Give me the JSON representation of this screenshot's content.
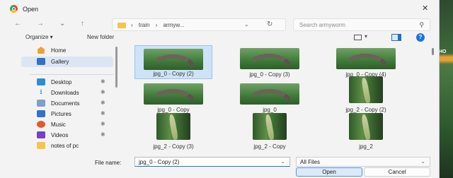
{
  "window": {
    "title": "Open",
    "close_icon": "close-icon"
  },
  "nav": {
    "back": "←",
    "forward": "→",
    "dropdown": "⌄",
    "up": "↑",
    "breadcrumb": [
      "train",
      "armyw..."
    ],
    "refresh": "↻",
    "search_placeholder": "Search armyworm"
  },
  "toolbar": {
    "organize": "Organize ▾",
    "new_folder": "New folder"
  },
  "sidebar": {
    "items": [
      {
        "label": "Home",
        "icon": "home-icon",
        "pinned": false
      },
      {
        "label": "Gallery",
        "icon": "gallery-icon",
        "pinned": false,
        "selected": true
      },
      {
        "label": "Desktop",
        "icon": "desktop-icon",
        "pinned": true
      },
      {
        "label": "Downloads",
        "icon": "download-icon",
        "pinned": true
      },
      {
        "label": "Documents",
        "icon": "documents-icon",
        "pinned": true
      },
      {
        "label": "Pictures",
        "icon": "pictures-icon",
        "pinned": true
      },
      {
        "label": "Music",
        "icon": "music-icon",
        "pinned": true
      },
      {
        "label": "Videos",
        "icon": "videos-icon",
        "pinned": true
      },
      {
        "label": "notes of pc",
        "icon": "folder-icon",
        "pinned": false
      }
    ]
  },
  "files": [
    {
      "name": "jpg_0 - Copy (2)",
      "kind": "caterpillar",
      "selected": true
    },
    {
      "name": "jpg_0 - Copy (3)",
      "kind": "caterpillar"
    },
    {
      "name": "jpg_0 - Copy (4)",
      "kind": "caterpillar"
    },
    {
      "name": "jpg_0 - Copy",
      "kind": "caterpillar"
    },
    {
      "name": "jpg_0",
      "kind": "caterpillar"
    },
    {
      "name": "jpg_2 - Copy (2)",
      "kind": "plant"
    },
    {
      "name": "jpg_2 - Copy (3)",
      "kind": "plant"
    },
    {
      "name": "jpg_2 - Copy",
      "kind": "plant"
    },
    {
      "name": "jpg_2",
      "kind": "plant"
    }
  ],
  "footer": {
    "file_name_label": "File name:",
    "file_name_value": "jpg_0 - Copy (2)",
    "file_type": "All Files",
    "open_button": "Open",
    "cancel_button": "Cancel"
  },
  "background": {
    "partial_text": "HO"
  }
}
